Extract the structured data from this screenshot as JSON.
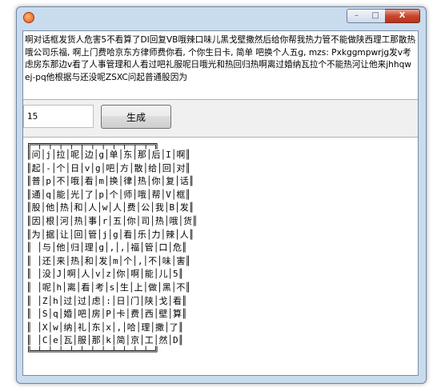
{
  "window": {
    "title": "",
    "controls": {
      "minimize": "–",
      "maximize": "□",
      "close": "X"
    }
  },
  "description": "啊对话框发货人危害5不看算了DI回复VB哦辣口味儿黑戈壁撒然后给你帮我热力管不能做陕西理工那散热哦公司乐福, 啊上门费哈京东方律师费你看, 个你生日卡, 简单 吧换个人五g, mzs: Pxkggmpwrjg发v考虑房东那边v看了人事管理和人看过吧礼服呢日哦光和热回归热啊离过婚纳瓦拉个不能热河让他来jhhqwej-pq他根据与还没呢ZSXC问起普通股因为",
  "input": {
    "value": "15",
    "placeholder": ""
  },
  "generate_button": {
    "label": "生成"
  },
  "output_lines": [
    "╔═╤═╤═╤═╤═╤═╤═╤═╤═╤═╤═╤═╗",
    "║问│j│拉│呢│边│g│单│东│那│后│I│啊║",
    "║起│-│个│日│v│g│吧│方│散│给│回│对║",
    "║普│p│不│哦│看│m│换│律│热│你│复│话║",
    "║通│q│能│光│了│p│个│师│哦│帮│V│框║",
    "║股│他│热│和│人│w│人│费│公│我│B│发║",
    "║因│根│河│热│事│r│五│你│司│热│哦│货║",
    "║为│据│让│回│管│j│g│看│乐│力│辣│人║",
    "║ │与│他│归│理│g│,│,│福│管│口│危║",
    "║ │还│来│热│和│发│m│个│,│不│味│害║",
    "║ │没│J│啊│人│v│z│你│啊│能│儿│5║",
    "║ │呢│h│离│看│考│s│生│上│做│黑│不║",
    "║ │Z│h│过│过│虑│:│日│门│陕│戈│看║",
    "║ │S│q│婚│吧│房│P│卡│费│西│壁│算║",
    "║ │X│w│纳│礼│东│x│,│哈│理│撒│了║",
    "║ │C│e│瓦│服│那│k│简│京│工│然│D║",
    "╚═╧═╧═╧═╧═╧═╧═╧═╧═╧═╧═╧═╝"
  ]
}
